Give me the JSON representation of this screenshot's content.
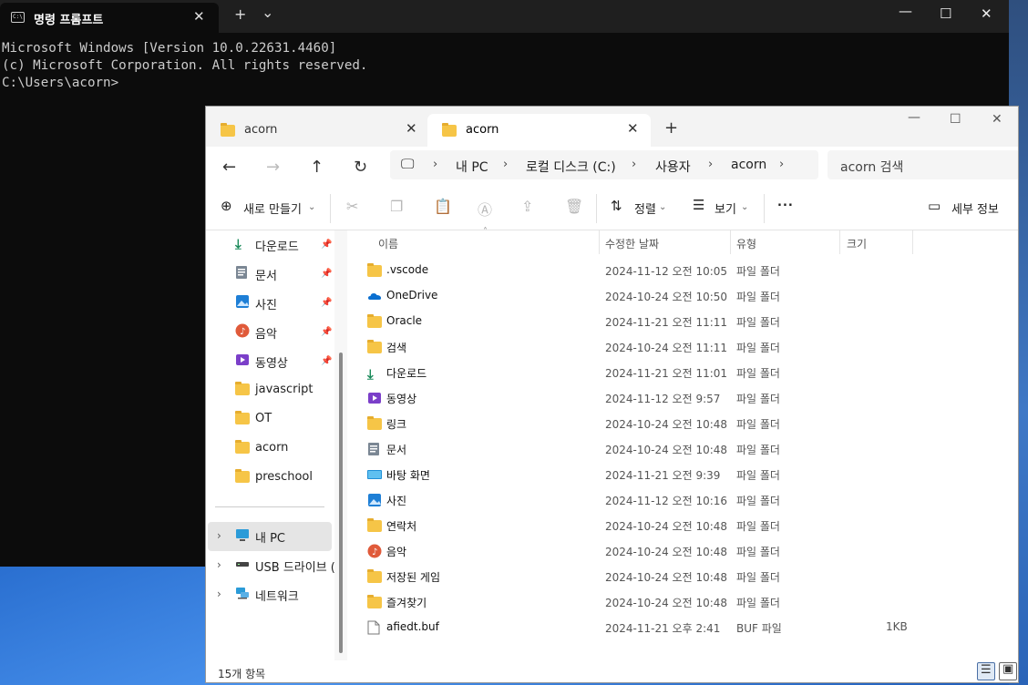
{
  "cmd": {
    "title": "명령 프롬프트",
    "lines": [
      "Microsoft Windows [Version 10.0.22631.4460]",
      "(c) Microsoft Corporation. All rights reserved.",
      "",
      "C:\\Users\\acorn>"
    ],
    "close_label": "✕",
    "new_tab_label": "+",
    "dropdown_label": "⌄",
    "minimize_label": "—",
    "maximize_label": "☐"
  },
  "explorer": {
    "tabs": [
      {
        "label": "acorn"
      },
      {
        "label": "acorn"
      }
    ],
    "breadcrumb": [
      "내 PC",
      "로컬 디스크 (C:)",
      "사용자",
      "acorn"
    ],
    "search_placeholder": "acorn 검색",
    "toolbar": {
      "new_label": "새로 만들기",
      "sort_label": "정렬",
      "view_label": "보기",
      "more_label": "...",
      "details_label": "세부 정보"
    },
    "sidebar": {
      "quick": [
        {
          "label": "다운로드",
          "icon": "download-icon",
          "pinned": true
        },
        {
          "label": "문서",
          "icon": "document-icon",
          "pinned": true
        },
        {
          "label": "사진",
          "icon": "pictures-icon",
          "pinned": true
        },
        {
          "label": "음악",
          "icon": "music-icon",
          "pinned": true
        },
        {
          "label": "동영상",
          "icon": "video-icon",
          "pinned": true
        },
        {
          "label": "javascript",
          "icon": "folder-icon",
          "pinned": false
        },
        {
          "label": "OT",
          "icon": "folder-icon",
          "pinned": false
        },
        {
          "label": "acorn",
          "icon": "folder-icon",
          "pinned": false
        },
        {
          "label": "preschool",
          "icon": "folder-icon",
          "pinned": false
        }
      ],
      "drives": [
        {
          "label": "내 PC",
          "icon": "pc-icon"
        },
        {
          "label": "USB 드라이브 (I",
          "icon": "usb-drive-icon"
        },
        {
          "label": "네트워크",
          "icon": "network-icon"
        }
      ]
    },
    "columns": [
      "이름",
      "수정한 날짜",
      "유형",
      "크기"
    ],
    "files": [
      {
        "name": ".vscode",
        "date": "2024-11-12 오전 10:05",
        "type": "파일 폴더",
        "size": "",
        "icon": "folder-icon"
      },
      {
        "name": "OneDrive",
        "date": "2024-10-24 오전 10:50",
        "type": "파일 폴더",
        "size": "",
        "icon": "onedrive-icon"
      },
      {
        "name": "Oracle",
        "date": "2024-11-21 오전 11:11",
        "type": "파일 폴더",
        "size": "",
        "icon": "folder-icon"
      },
      {
        "name": "검색",
        "date": "2024-10-24 오전 11:11",
        "type": "파일 폴더",
        "size": "",
        "icon": "folder-icon"
      },
      {
        "name": "다운로드",
        "date": "2024-11-21 오전 11:01",
        "type": "파일 폴더",
        "size": "",
        "icon": "download-icon"
      },
      {
        "name": "동영상",
        "date": "2024-11-12 오전 9:57",
        "type": "파일 폴더",
        "size": "",
        "icon": "video-icon"
      },
      {
        "name": "링크",
        "date": "2024-10-24 오전 10:48",
        "type": "파일 폴더",
        "size": "",
        "icon": "folder-icon"
      },
      {
        "name": "문서",
        "date": "2024-10-24 오전 10:48",
        "type": "파일 폴더",
        "size": "",
        "icon": "document-icon"
      },
      {
        "name": "바탕 화면",
        "date": "2024-11-21 오전 9:39",
        "type": "파일 폴더",
        "size": "",
        "icon": "desktop-icon"
      },
      {
        "name": "사진",
        "date": "2024-11-12 오전 10:16",
        "type": "파일 폴더",
        "size": "",
        "icon": "pictures-icon"
      },
      {
        "name": "연락처",
        "date": "2024-10-24 오전 10:48",
        "type": "파일 폴더",
        "size": "",
        "icon": "folder-icon"
      },
      {
        "name": "음악",
        "date": "2024-10-24 오전 10:48",
        "type": "파일 폴더",
        "size": "",
        "icon": "music-icon"
      },
      {
        "name": "저장된 게임",
        "date": "2024-10-24 오전 10:48",
        "type": "파일 폴더",
        "size": "",
        "icon": "folder-icon"
      },
      {
        "name": "즐겨찾기",
        "date": "2024-10-24 오전 10:48",
        "type": "파일 폴더",
        "size": "",
        "icon": "folder-icon"
      },
      {
        "name": "afiedt.buf",
        "date": "2024-11-21 오후 2:41",
        "type": "BUF 파일",
        "size": "1KB",
        "icon": "file-icon"
      }
    ],
    "status": "15개 항목"
  }
}
